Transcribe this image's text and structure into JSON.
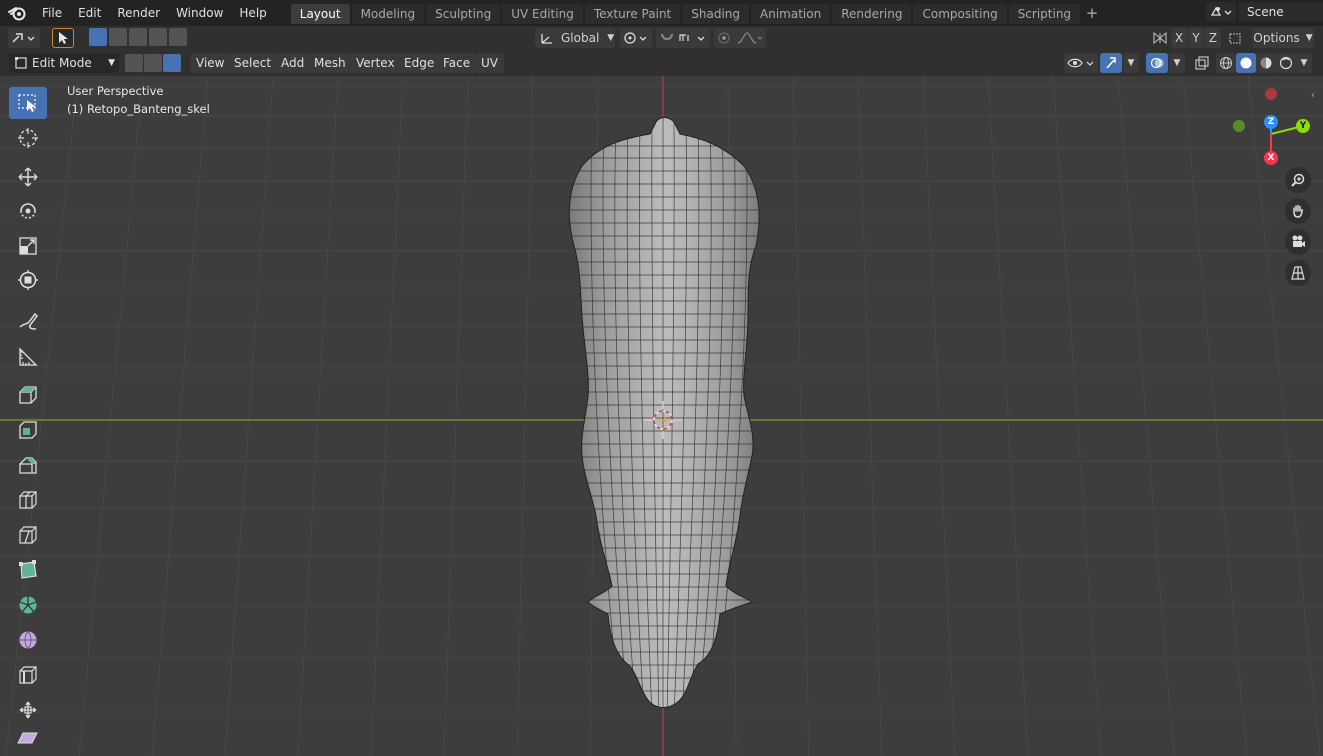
{
  "topbar": {
    "menus": [
      "File",
      "Edit",
      "Render",
      "Window",
      "Help"
    ],
    "workspaces": [
      "Layout",
      "Modeling",
      "Sculpting",
      "UV Editing",
      "Texture Paint",
      "Shading",
      "Animation",
      "Rendering",
      "Compositing",
      "Scripting"
    ],
    "active_workspace": "Layout",
    "add_workspace": "+",
    "scene_name": "Scene"
  },
  "tool_header": {
    "orientation": "Global",
    "axes": [
      "X",
      "Y",
      "Z"
    ],
    "options_label": "Options"
  },
  "edit_header": {
    "mode": "Edit Mode",
    "menus": [
      "View",
      "Select",
      "Add",
      "Mesh",
      "Vertex",
      "Edge",
      "Face",
      "UV"
    ]
  },
  "viewport": {
    "perspective_label": "User Perspective",
    "object_label": "(1) Retopo_Banteng_skel"
  },
  "gizmo": {
    "z_label": "Z",
    "y_label": "Y",
    "x_label": "X"
  },
  "colors": {
    "accent": "#4772b3",
    "x_axis": "#ff3352",
    "y_axis": "#8bdc00",
    "z_axis": "#2890ff",
    "grid_y_line": "#6f9b3a",
    "grid_x_line": "#a84040"
  }
}
